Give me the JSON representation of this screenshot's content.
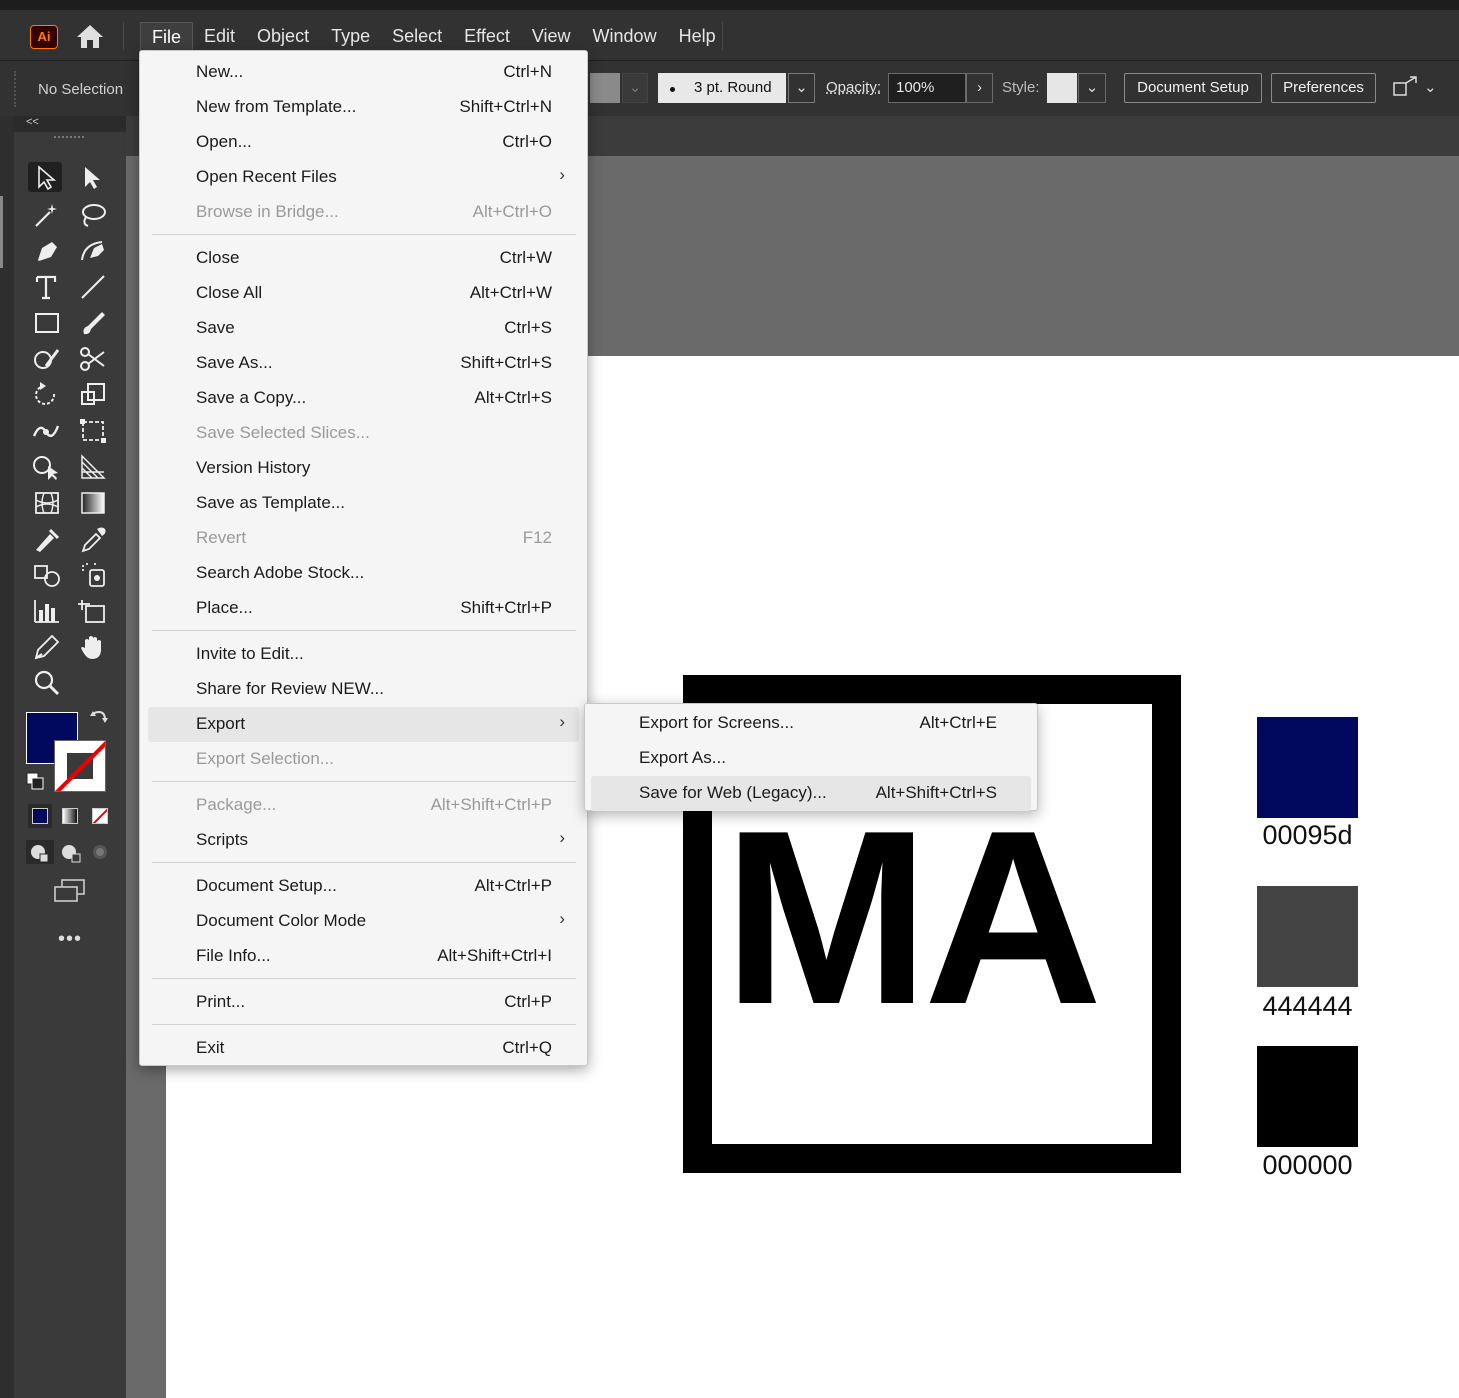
{
  "app": {
    "logo_text": "Ai",
    "menus": [
      "File",
      "Edit",
      "Object",
      "Type",
      "Select",
      "Effect",
      "View",
      "Window",
      "Help"
    ],
    "active_menu": "File"
  },
  "control_bar": {
    "selection_label": "No Selection",
    "brush_label": "3 pt. Round",
    "opacity_label": "Opacity:",
    "opacity_value": "100%",
    "style_label": "Style:",
    "document_setup_button": "Document Setup",
    "preferences_button": "Preferences"
  },
  "toolbar": {
    "collapse_label": "<<",
    "more_label": "•••",
    "fill_color": "#00095d",
    "stroke": "none"
  },
  "file_menu": {
    "items": [
      {
        "label": "New...",
        "shortcut": "Ctrl+N",
        "disabled": false
      },
      {
        "label": "New from Template...",
        "shortcut": "Shift+Ctrl+N",
        "disabled": false
      },
      {
        "label": "Open...",
        "shortcut": "Ctrl+O",
        "disabled": false
      },
      {
        "label": "Open Recent Files",
        "shortcut": "",
        "submenu": true,
        "disabled": false
      },
      {
        "label": "Browse in Bridge...",
        "shortcut": "Alt+Ctrl+O",
        "disabled": true
      },
      {
        "label": "Close",
        "shortcut": "Ctrl+W",
        "disabled": false
      },
      {
        "label": "Close All",
        "shortcut": "Alt+Ctrl+W",
        "disabled": false
      },
      {
        "label": "Save",
        "shortcut": "Ctrl+S",
        "disabled": false
      },
      {
        "label": "Save As...",
        "shortcut": "Shift+Ctrl+S",
        "disabled": false
      },
      {
        "label": "Save a Copy...",
        "shortcut": "Alt+Ctrl+S",
        "disabled": false
      },
      {
        "label": "Save Selected Slices...",
        "shortcut": "",
        "disabled": true
      },
      {
        "label": "Version History",
        "shortcut": "",
        "disabled": false
      },
      {
        "label": "Save as Template...",
        "shortcut": "",
        "disabled": false
      },
      {
        "label": "Revert",
        "shortcut": "F12",
        "disabled": true
      },
      {
        "label": "Search Adobe Stock...",
        "shortcut": "",
        "disabled": false
      },
      {
        "label": "Place...",
        "shortcut": "Shift+Ctrl+P",
        "disabled": false
      },
      {
        "label": "Invite to Edit...",
        "shortcut": "",
        "disabled": false
      },
      {
        "label": "Share for Review NEW...",
        "shortcut": "",
        "disabled": false
      },
      {
        "label": "Export",
        "shortcut": "",
        "submenu": true,
        "highlighted": true,
        "disabled": false
      },
      {
        "label": "Export Selection...",
        "shortcut": "",
        "disabled": true
      },
      {
        "label": "Package...",
        "shortcut": "Alt+Shift+Ctrl+P",
        "disabled": true
      },
      {
        "label": "Scripts",
        "shortcut": "",
        "submenu": true,
        "disabled": false
      },
      {
        "label": "Document Setup...",
        "shortcut": "Alt+Ctrl+P",
        "disabled": false
      },
      {
        "label": "Document Color Mode",
        "shortcut": "",
        "submenu": true,
        "disabled": false
      },
      {
        "label": "File Info...",
        "shortcut": "Alt+Shift+Ctrl+I",
        "disabled": false
      },
      {
        "label": "Print...",
        "shortcut": "Ctrl+P",
        "disabled": false
      },
      {
        "label": "Exit",
        "shortcut": "Ctrl+Q",
        "disabled": false
      }
    ]
  },
  "export_menu": {
    "items": [
      {
        "label": "Export for Screens...",
        "shortcut": "Alt+Ctrl+E",
        "highlighted": false
      },
      {
        "label": "Export As...",
        "shortcut": "",
        "highlighted": false
      },
      {
        "label": "Save for Web (Legacy)...",
        "shortcut": "Alt+Shift+Ctrl+S",
        "highlighted": true
      }
    ]
  },
  "artboard": {
    "logo_text": "MA",
    "swatches": [
      {
        "color": "#00095d",
        "label": "00095d"
      },
      {
        "color": "#444444",
        "label": "444444"
      },
      {
        "color": "#000000",
        "label": "000000"
      }
    ]
  }
}
